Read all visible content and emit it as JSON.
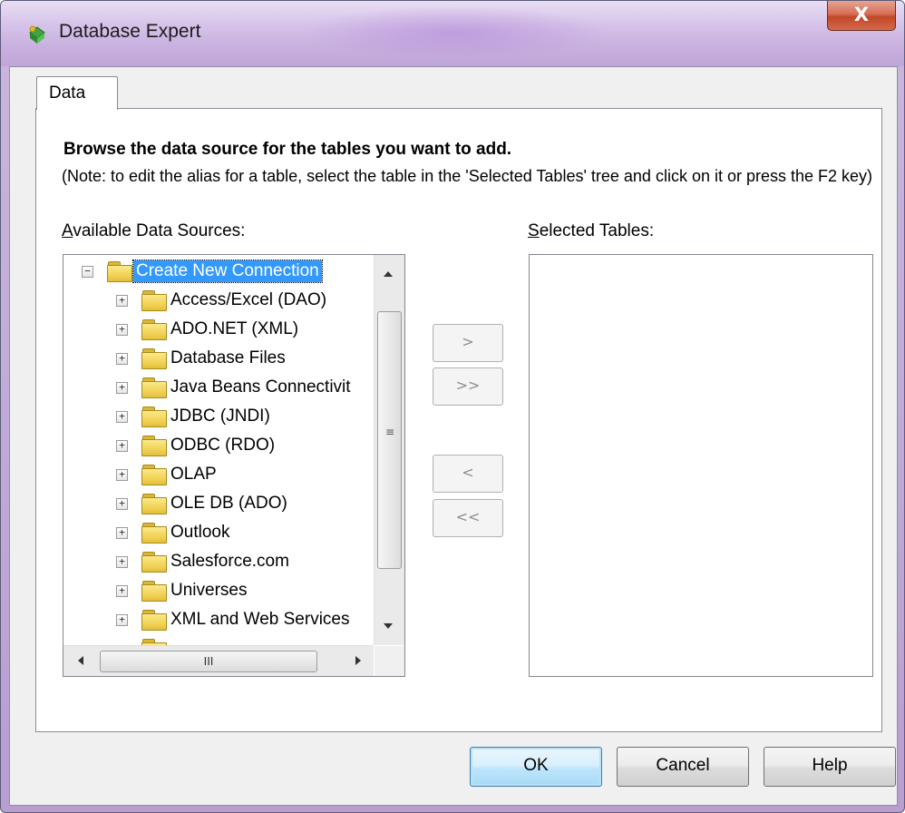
{
  "window": {
    "title": "Database Expert",
    "close_glyph": "X",
    "app_icon": "database-expert-icon"
  },
  "tabs": [
    {
      "label": "Data",
      "active": true
    }
  ],
  "content": {
    "heading": "Browse the data source for the tables you want to add.",
    "note": "(Note: to edit the alias for a table, select the table in the 'Selected Tables' tree and click on it or press the F2 key)",
    "available_label_accel": "A",
    "available_label_rest": "vailable Data Sources:",
    "selected_label_accel": "S",
    "selected_label_rest": "elected Tables:"
  },
  "tree": {
    "root": {
      "label": "Create New Connection",
      "expanded": true,
      "selected": true,
      "expander": "−"
    },
    "children": [
      {
        "label": "Access/Excel (DAO)",
        "expander": "+"
      },
      {
        "label": "ADO.NET (XML)",
        "expander": "+"
      },
      {
        "label": "Database Files",
        "expander": "+"
      },
      {
        "label": "Java Beans Connectivit",
        "expander": "+"
      },
      {
        "label": "JDBC (JNDI)",
        "expander": "+"
      },
      {
        "label": "ODBC (RDO)",
        "expander": "+"
      },
      {
        "label": "OLAP",
        "expander": "+"
      },
      {
        "label": "OLE DB (ADO)",
        "expander": "+"
      },
      {
        "label": "Outlook",
        "expander": "+"
      },
      {
        "label": "Salesforce.com",
        "expander": "+"
      },
      {
        "label": "Universes",
        "expander": "+"
      },
      {
        "label": "XML and Web Services",
        "expander": "+"
      }
    ],
    "hscroll_thumb_glyph": "III",
    "vscroll_grip_glyph": "≡"
  },
  "move_buttons": {
    "add": ">",
    "add_all": ">>",
    "remove": "<",
    "remove_all": "<<"
  },
  "buttons": {
    "ok": "OK",
    "cancel": "Cancel",
    "help": "Help"
  },
  "colors": {
    "selection": "#3399ff",
    "close_button": "#c24727",
    "default_button_border": "#3c7fb1"
  }
}
